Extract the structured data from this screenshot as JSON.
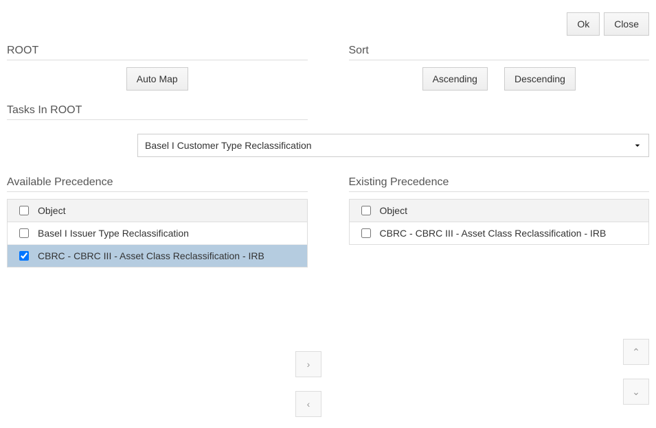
{
  "buttons": {
    "ok": "Ok",
    "close": "Close",
    "auto_map": "Auto Map",
    "ascending": "Ascending",
    "descending": "Descending"
  },
  "labels": {
    "root": "ROOT",
    "sort": "Sort",
    "tasks_in_root": "Tasks In ROOT",
    "available_precedence": "Available Precedence",
    "existing_precedence": "Existing Precedence",
    "object_header": "Object"
  },
  "tasks_select": {
    "selected": "Basel I Customer Type Reclassification"
  },
  "available": [
    {
      "label": "Basel I Issuer Type Reclassification",
      "checked": false,
      "selected": false
    },
    {
      "label": "CBRC - CBRC III - Asset Class Reclassification - IRB",
      "checked": true,
      "selected": true
    }
  ],
  "existing": [
    {
      "label": "CBRC - CBRC III - Asset Class Reclassification - IRB",
      "checked": false,
      "selected": false
    }
  ],
  "icons": {
    "right": "›",
    "left": "‹",
    "up": "⌃",
    "down": "⌄"
  }
}
